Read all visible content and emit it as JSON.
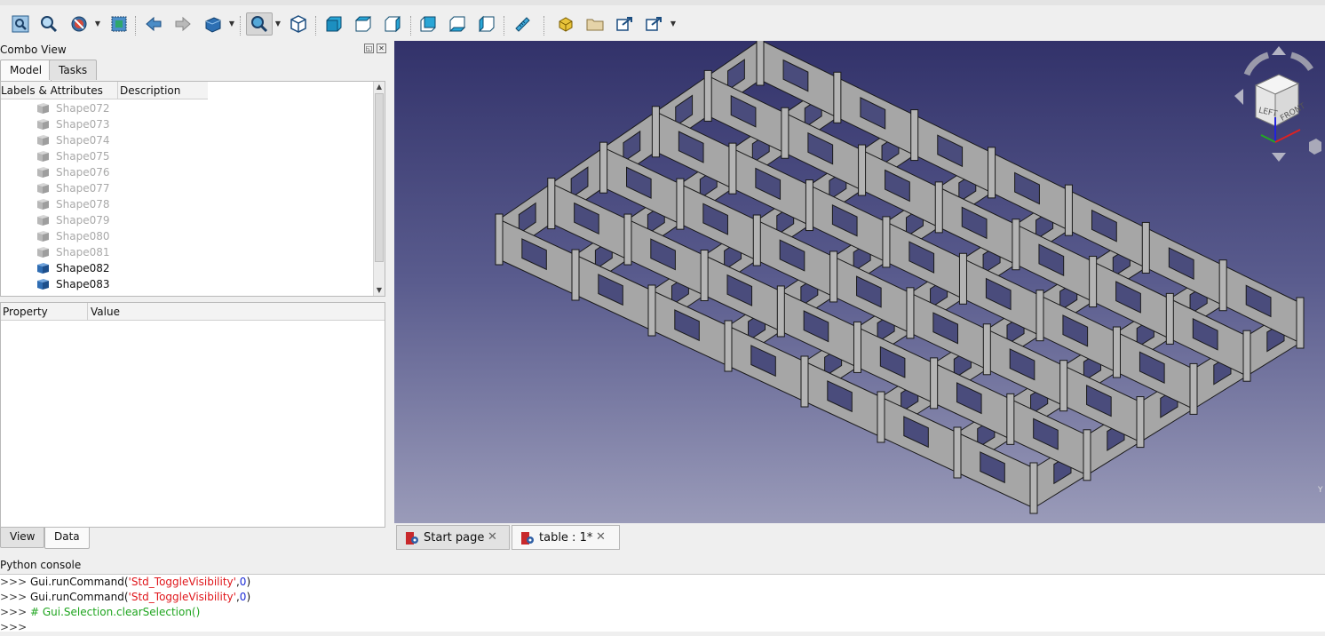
{
  "combo": {
    "title": "Combo View",
    "tabs_top": [
      "Model",
      "Tasks"
    ],
    "tree_headers": [
      "Labels & Attributes",
      "Description"
    ],
    "tree_items": [
      {
        "label": "Shape072",
        "hidden": true
      },
      {
        "label": "Shape073",
        "hidden": true
      },
      {
        "label": "Shape074",
        "hidden": true
      },
      {
        "label": "Shape075",
        "hidden": true
      },
      {
        "label": "Shape076",
        "hidden": true
      },
      {
        "label": "Shape077",
        "hidden": true
      },
      {
        "label": "Shape078",
        "hidden": true
      },
      {
        "label": "Shape079",
        "hidden": true
      },
      {
        "label": "Shape080",
        "hidden": true
      },
      {
        "label": "Shape081",
        "hidden": true
      },
      {
        "label": "Shape082",
        "hidden": false
      },
      {
        "label": "Shape083",
        "hidden": false
      }
    ],
    "prop_headers": [
      "Property",
      "Value"
    ],
    "tabs_bottom": [
      "View",
      "Data"
    ]
  },
  "toolbar": {
    "icons": [
      "fit-all-icon",
      "fit-selection-icon",
      "draw-style-icon",
      "bounding-box-icon",
      "back-icon",
      "forward-icon",
      "workbench-icon",
      "zoom-icon",
      "isometric-view-icon",
      "front-view-icon",
      "top-view-icon",
      "right-view-icon",
      "rear-view-icon",
      "bottom-view-icon",
      "left-view-icon",
      "measure-icon",
      "part-icon",
      "group-icon",
      "link-icon",
      "link-actions-icon"
    ]
  },
  "navcube": {
    "left_face": "LEFT",
    "front_face": "FRONT",
    "axis_label": "Y"
  },
  "doc_tabs": [
    {
      "label": "Start page",
      "active": false
    },
    {
      "label": "table : 1*",
      "active": true
    }
  ],
  "console": {
    "title": "Python console",
    "prompt": ">>> ",
    "lines": [
      {
        "call": "Gui.runCommand(",
        "arg": "'Std_ToggleVisibility'",
        "comma": ",",
        "num": "0",
        "close": ")"
      },
      {
        "call": "Gui.runCommand(",
        "arg": "'Std_ToggleVisibility'",
        "comma": ",",
        "num": "0",
        "close": ")"
      }
    ],
    "comment": "# Gui.Selection.clearSelection()"
  },
  "colors": {
    "viewport_top": "#32326a",
    "viewport_bottom": "#9a9bb9",
    "model_face": "#a6a6a6",
    "model_edge": "#1a1a1a"
  }
}
